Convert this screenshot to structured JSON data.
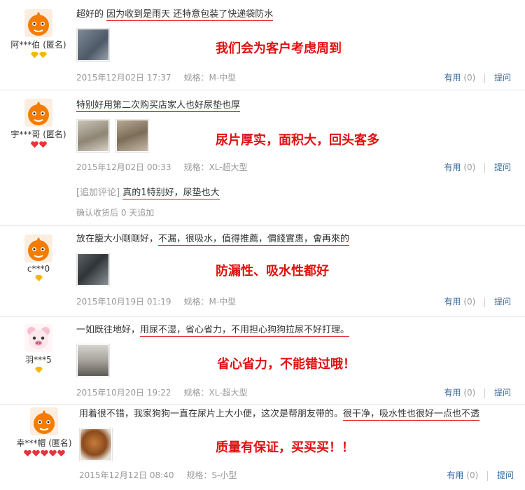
{
  "common": {
    "useful_label": "有用",
    "ask_label": "提问"
  },
  "reviews": [
    {
      "user": "阿***伯 (匿名)",
      "badge_count": 2,
      "badge_color": "#f5b800",
      "avatar_style": "orange-mascot",
      "text_plain": "超好的",
      "text_underlined": "因为收到是雨天 还特意包装了快递袋防水",
      "annotation": "我们会为客户考虑周到",
      "date": "2015年12月02日 17:37",
      "sku": "规格：M-中型",
      "useful_count": "(0)"
    },
    {
      "user": "宇***哥 (匿名)",
      "badge_count": 2,
      "badge_color": "#e8333b",
      "avatar_style": "orange-mascot",
      "text_plain": "",
      "text_underlined": "特别好用第二次购买店家人也好尿垫也厚",
      "annotation": "尿片厚实，面积大，回头客多",
      "date": "2015年12月02日 00:33",
      "sku": "规格：XL-超大型",
      "useful_count": "(0)",
      "append_tag": "[追加评论]",
      "append_text": "真的1特别好，尿垫也大",
      "append_meta": "确认收货后 0 天追加"
    },
    {
      "user": "c***0",
      "badge_count": 1,
      "badge_color": "#f5b800",
      "avatar_style": "orange-mascot",
      "text_plain": "放在籠大小剛剛好，",
      "text_underlined": "不漏，很吸水，值得推薦，價錢實惠，會再來的",
      "annotation": "防漏性、吸水性都好",
      "date": "2015年10月19日 01:19",
      "sku": "规格：M-中型",
      "useful_count": "(0)"
    },
    {
      "user": "羽***5",
      "badge_count": 1,
      "badge_color": "#f5b800",
      "avatar_style": "pink-bear",
      "text_plain": "一如既往地好，",
      "text_underlined": "用尿不湿，省心省力，不用担心狗狗拉尿不好打理。",
      "annotation": "省心省力，不能错过哦！",
      "date": "2015年10月20日 19:22",
      "sku": "规格：XL-超大型",
      "useful_count": "(0)"
    },
    {
      "user": "幸***帽 (匿名)",
      "badge_count": 5,
      "badge_color": "#e8333b",
      "avatar_style": "orange-mascot",
      "text_plain": "用着很不错，我家狗狗一直在尿片上大小便，这次是帮朋友带的。",
      "text_underlined": "很干净，吸水性也很好一点也不透",
      "annotation": "质量有保证，买买买！！",
      "date": "2015年12月12日 08:40",
      "sku": "规格：S-小型",
      "useful_count": "(0)"
    }
  ]
}
